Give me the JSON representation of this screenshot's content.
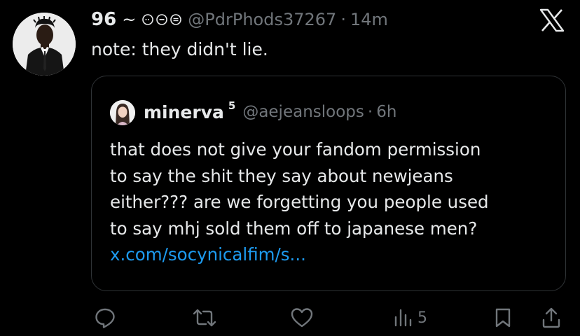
{
  "tweet": {
    "author_name": "96",
    "separator": "~",
    "emojis": [
      "circle-dash-icon",
      "circle-minus-icon",
      "circle-equal-icon"
    ],
    "handle": "@PdrPhods37267",
    "dot": "·",
    "time": "14m",
    "text": "note: they didn't lie."
  },
  "quote": {
    "author_name": "minerva",
    "badge": "5",
    "handle": "@aejeansloops",
    "dot": "·",
    "time": "6h",
    "lines": [
      "that does not give your fandom permission",
      "to say the shit they say about newjeans",
      "either??? are we forgetting you people used",
      "to say mhj sold them off to japanese men?"
    ],
    "link": "x.com/socynicalfim/s..."
  },
  "actions": {
    "views_count": "5"
  },
  "colors": {
    "background": "#000000",
    "text": "#e7e9ea",
    "muted": "#71767b",
    "link": "#1d9bf0",
    "border": "#2f3336"
  }
}
